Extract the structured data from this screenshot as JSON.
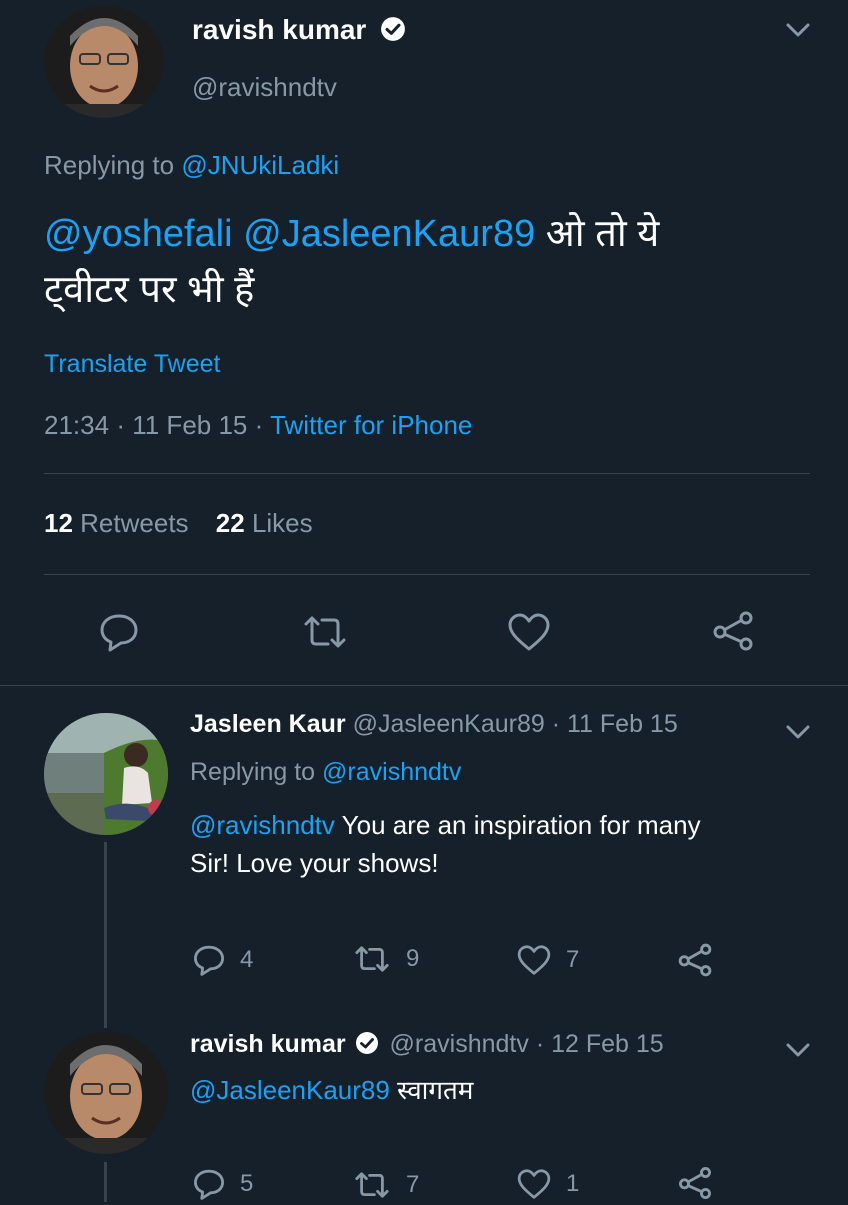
{
  "main_tweet": {
    "author_name": "ravish kumar",
    "handle": "@ravishndtv",
    "replying_prefix": "Replying to",
    "replying_to": "@JNUkiLadki",
    "mention1": "@yoshefali",
    "mention2": "@JasleenKaur89",
    "text_line1": "ओ तो ये",
    "text_line2": "ट्वीटर पर भी हैं",
    "translate_label": "Translate Tweet",
    "time": "21:34",
    "date": "11 Feb 15",
    "source": "Twitter for iPhone",
    "separator": "·",
    "retweets_count": "12",
    "retweets_label": "Retweets",
    "likes_count": "22",
    "likes_label": "Likes"
  },
  "reply1": {
    "author_name": "Jasleen Kaur",
    "handle": "@JasleenKaur89",
    "date": "· 11 Feb 15",
    "replying_prefix": "Replying to",
    "replying_to": "@ravishndtv",
    "mention": "@ravishndtv",
    "text_line1": "You are an inspiration for many",
    "text_line2": "Sir! Love your shows!",
    "reply_count": "4",
    "retweet_count": "9",
    "like_count": "7"
  },
  "reply2": {
    "author_name": "ravish kumar",
    "handle": "@ravishndtv",
    "date": "· 12 Feb 15",
    "mention": "@JasleenKaur89",
    "text": "स्वागतम",
    "reply_count": "5",
    "retweet_count": "7",
    "like_count": "1"
  },
  "colors": {
    "background": "#15202b",
    "link": "#1da1f2",
    "muted": "#8899a6",
    "divider": "#38444d"
  }
}
